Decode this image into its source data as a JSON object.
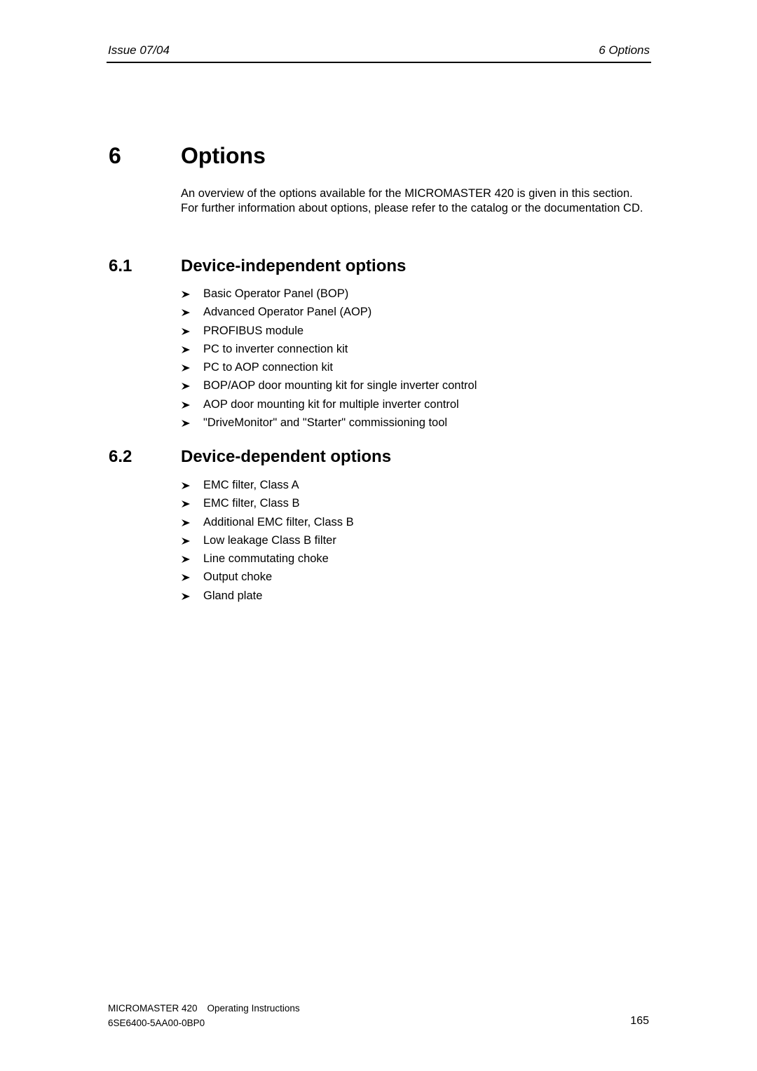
{
  "header": {
    "issue": "Issue 07/04",
    "chapter_ref": "6  Options"
  },
  "chapter": {
    "number": "6",
    "title": "Options",
    "intro": "An overview of the options available for the MICROMASTER 420 is given in this section. For further information about options, please refer to the catalog or the documentation CD."
  },
  "sections": [
    {
      "number": "6.1",
      "title": "Device-independent options",
      "bullet_icon": "arrowhead-bullet-icon",
      "items": [
        "Basic Operator Panel (BOP)",
        "Advanced Operator Panel (AOP)",
        "PROFIBUS module",
        "PC to inverter connection kit",
        "PC to AOP connection kit",
        "BOP/AOP door mounting kit for single inverter control",
        "AOP door mounting kit for multiple inverter control",
        "\"DriveMonitor\" and \"Starter\" commissioning tool"
      ]
    },
    {
      "number": "6.2",
      "title": "Device-dependent options",
      "bullet_icon": "arrowhead-bullet-icon",
      "items": [
        "EMC filter, Class A",
        "EMC filter, Class B",
        "Additional EMC filter, Class B",
        "Low leakage Class B filter",
        "Line commutating choke",
        "Output choke",
        "Gland plate"
      ]
    }
  ],
  "footer": {
    "product": "MICROMASTER 420",
    "doc_type": "Operating Instructions",
    "order_number": "6SE6400-5AA00-0BP0",
    "page_number": "165"
  }
}
